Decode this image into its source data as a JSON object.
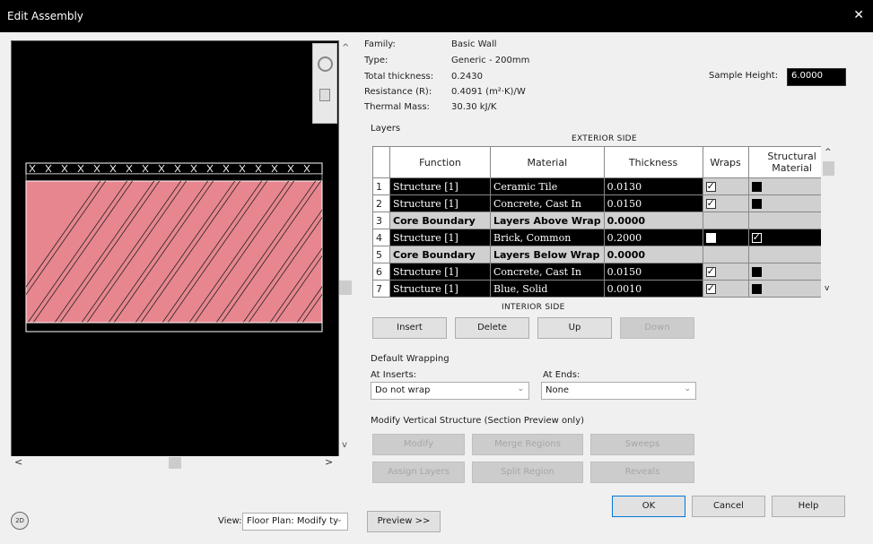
{
  "window": {
    "title": "Edit Assembly",
    "close_glyph": "✕"
  },
  "properties": [
    {
      "label": "Family:",
      "value": "Basic Wall"
    },
    {
      "label": "Type:",
      "value": "Generic - 200mm"
    },
    {
      "label": "Total thickness:",
      "value": "0.2430"
    },
    {
      "label": "Resistance (R):",
      "value": "0.4091 (m²·K)/W"
    },
    {
      "label": "Thermal Mass:",
      "value": "30.30 kJ/K"
    }
  ],
  "sample_height": {
    "label": "Sample Height:",
    "value": "6.0000"
  },
  "layers": {
    "label": "Layers",
    "exterior_label": "EXTERIOR SIDE",
    "interior_label": "INTERIOR SIDE",
    "columns": [
      "Function",
      "Material",
      "Thickness",
      "Wraps",
      "Structural Material"
    ],
    "rows": [
      {
        "num": "1",
        "function": "Structure [1]",
        "material": "Ceramic Tile",
        "thickness": "0.0130",
        "wraps": "checked",
        "structural": "filled",
        "kind": "dark"
      },
      {
        "num": "2",
        "function": "Structure [1]",
        "material": "Concrete, Cast In",
        "thickness": "0.0150",
        "wraps": "checked",
        "structural": "filled",
        "kind": "dark"
      },
      {
        "num": "3",
        "function": "Core Boundary",
        "material": "Layers Above Wrap",
        "thickness": "0.0000",
        "wraps": "",
        "structural": "",
        "kind": "core"
      },
      {
        "num": "4",
        "function": "Structure [1]",
        "material": "Brick, Common",
        "thickness": "0.2000",
        "wraps": "filled",
        "structural": "checked",
        "kind": "dark"
      },
      {
        "num": "5",
        "function": "Core Boundary",
        "material": "Layers Below Wrap",
        "thickness": "0.0000",
        "wraps": "",
        "structural": "",
        "kind": "core"
      },
      {
        "num": "6",
        "function": "Structure [1]",
        "material": "Concrete, Cast In",
        "thickness": "0.0150",
        "wraps": "checked",
        "structural": "filled",
        "kind": "dark"
      },
      {
        "num": "7",
        "function": "Structure [1]",
        "material": "Blue, Solid",
        "thickness": "0.0010",
        "wraps": "checked",
        "structural": "filled",
        "kind": "dark"
      }
    ]
  },
  "layer_buttons": {
    "insert": "Insert",
    "delete": "Delete",
    "up": "Up",
    "down": "Down"
  },
  "default_wrapping": {
    "label": "Default Wrapping",
    "at_inserts_label": "At Inserts:",
    "at_inserts_value": "Do not wrap",
    "at_ends_label": "At Ends:",
    "at_ends_value": "None"
  },
  "modify_vertical": {
    "label": "Modify Vertical Structure (Section Preview only)",
    "modify": "Modify",
    "merge_regions": "Merge Regions",
    "sweeps": "Sweeps",
    "assign_layers": "Assign Layers",
    "split_region": "Split Region",
    "reveals": "Reveals"
  },
  "footer": {
    "view_label": "View:",
    "view_value": "Floor Plan: Modify ty",
    "preview_button": "Preview >>",
    "ok": "OK",
    "cancel": "Cancel",
    "help": "Help"
  },
  "colors": {
    "wall_fill": "#e8868f",
    "titlebar": "#000000",
    "dialog_bg": "#f0f0f0"
  },
  "icons": [
    "close-icon",
    "zoom-icon",
    "page-icon",
    "2d-view-icon",
    "chevron-down-icon",
    "scroll-up-icon",
    "scroll-down-icon"
  ]
}
